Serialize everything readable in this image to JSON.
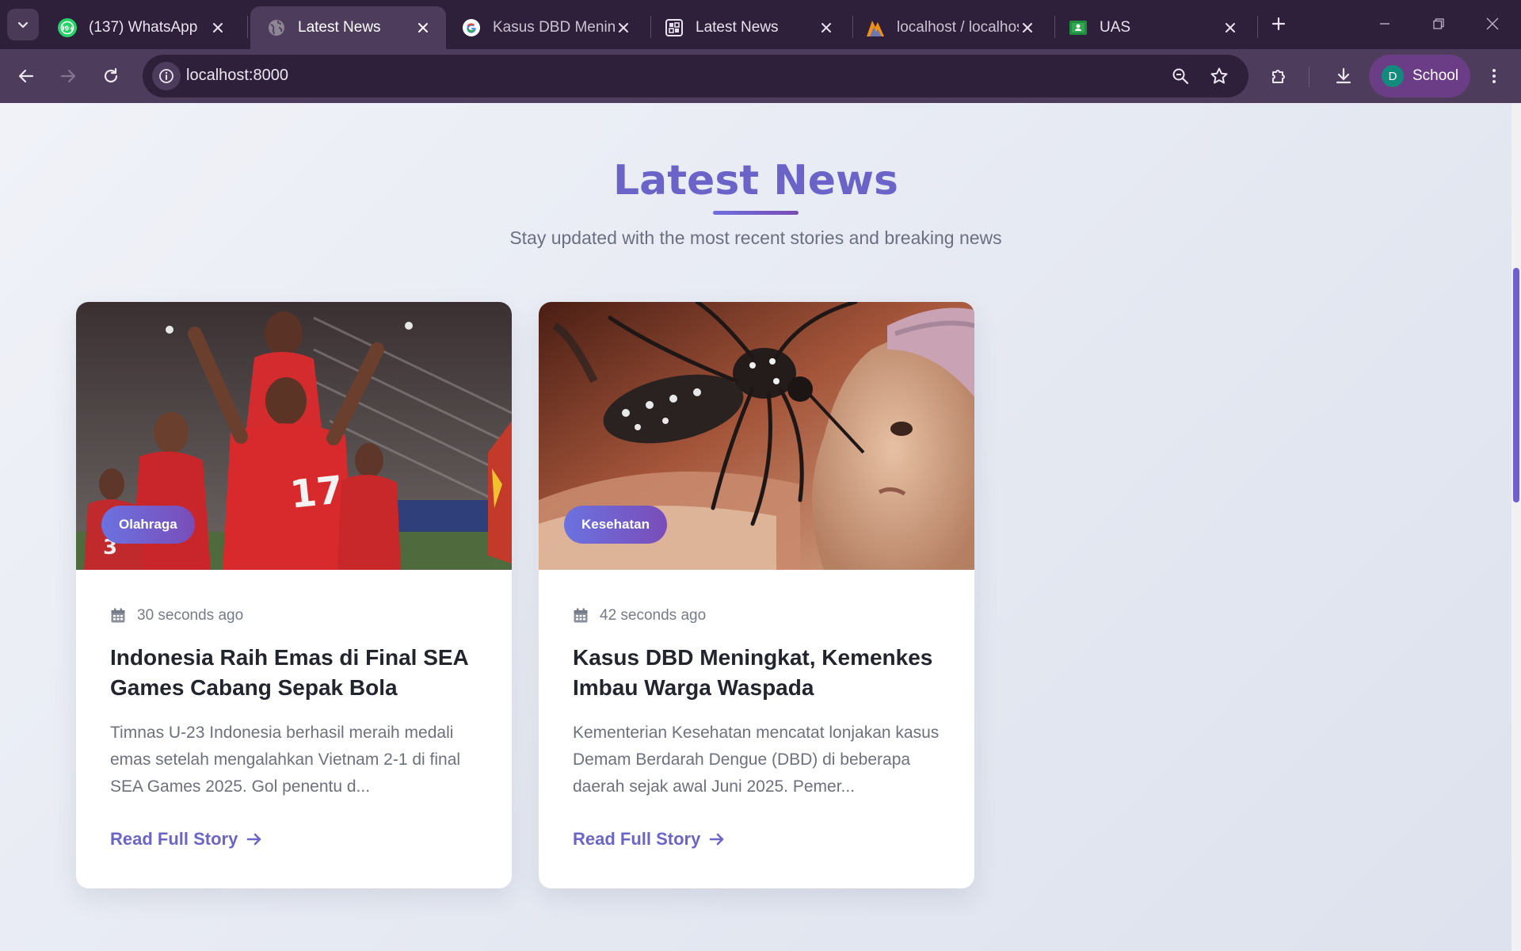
{
  "browser": {
    "tabs": [
      {
        "title": "(137) WhatsApp",
        "icon": "whatsapp-icon"
      },
      {
        "title": "Latest News",
        "icon": "globe-icon",
        "active": true
      },
      {
        "title": "Kasus DBD Meningkat",
        "icon": "google-icon"
      },
      {
        "title": "Latest News",
        "icon": "page-grid-icon"
      },
      {
        "title": "localhost / localhost",
        "icon": "phpmyadmin-icon"
      },
      {
        "title": "UAS",
        "icon": "classroom-icon"
      }
    ],
    "address": "localhost:8000",
    "profile": {
      "initial": "D",
      "name": "School"
    }
  },
  "page": {
    "title": "Latest News",
    "subtitle": "Stay updated with the most recent stories and breaking news",
    "read_more_label": "Read Full Story",
    "articles": [
      {
        "category": "Olahraga",
        "time": "30 seconds ago",
        "title": "Indonesia Raih Emas di Final SEA Games Cabang Sepak Bola",
        "excerpt": "Timnas U-23 Indonesia berhasil meraih medali emas setelah mengalahkan Vietnam 2-1 di final SEA Games 2025. Gol penentu d..."
      },
      {
        "category": "Kesehatan",
        "time": "42 seconds ago",
        "title": "Kasus DBD Meningkat, Kemenkes Imbau Warga Waspada",
        "excerpt": "Kementerian Kesehatan mencatat lonjakan kasus Demam Berdarah Dengue (DBD) di beberapa daerah sejak awal Juni 2025. Pemer..."
      }
    ]
  },
  "colors": {
    "accent": "#6b63c8",
    "chrome_dark": "#2e1f3b",
    "chrome_mid": "#4d3c5c",
    "badge_start": "#6b72e0",
    "badge_end": "#7a4db8"
  }
}
